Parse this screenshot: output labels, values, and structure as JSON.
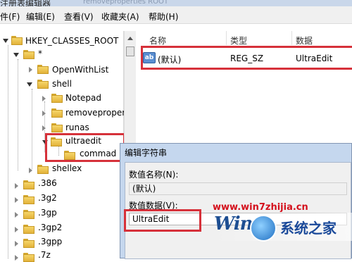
{
  "window": {
    "title": "注册表编辑器",
    "title_ghost": "removeproperties  ROOT"
  },
  "menu": [
    {
      "label": "件(F)"
    },
    {
      "label": "编辑(E)"
    },
    {
      "label": "查看(V)"
    },
    {
      "label": "收藏夹(A)"
    },
    {
      "label": "帮助(H)"
    }
  ],
  "tree": {
    "root": "HKEY_CLASSES_ROOT",
    "star": "*",
    "openwithlist": "OpenWithList",
    "shell": "shell",
    "notepad": "Notepad",
    "removeproper": "removeproper",
    "runas": "runas",
    "ultraedit": "ultraedit",
    "commad": "commad",
    "shellex": "shellex",
    "ext": [
      ".386",
      ".3g2",
      ".3gp",
      ".3gp2",
      ".3gpp",
      ".7z"
    ]
  },
  "list": {
    "headers": {
      "name": "名称",
      "type": "类型",
      "data": "数据"
    },
    "rows": [
      {
        "icon": "ab",
        "name": "(默认)",
        "type": "REG_SZ",
        "data": "UltraEdit"
      }
    ]
  },
  "dialog": {
    "title": "编辑字符串",
    "name_label": "数值名称(N):",
    "name_value": "(默认)",
    "data_label": "数值数据(V):",
    "data_value": "UltraEdit"
  },
  "watermark": {
    "url": "www.win7zhijia.cn",
    "win": "Win",
    "brand": "系统之家"
  },
  "colors": {
    "highlight_red": "#d6313a",
    "watermark_red": "#d4101c",
    "watermark_blue": "#1b4a9a"
  }
}
